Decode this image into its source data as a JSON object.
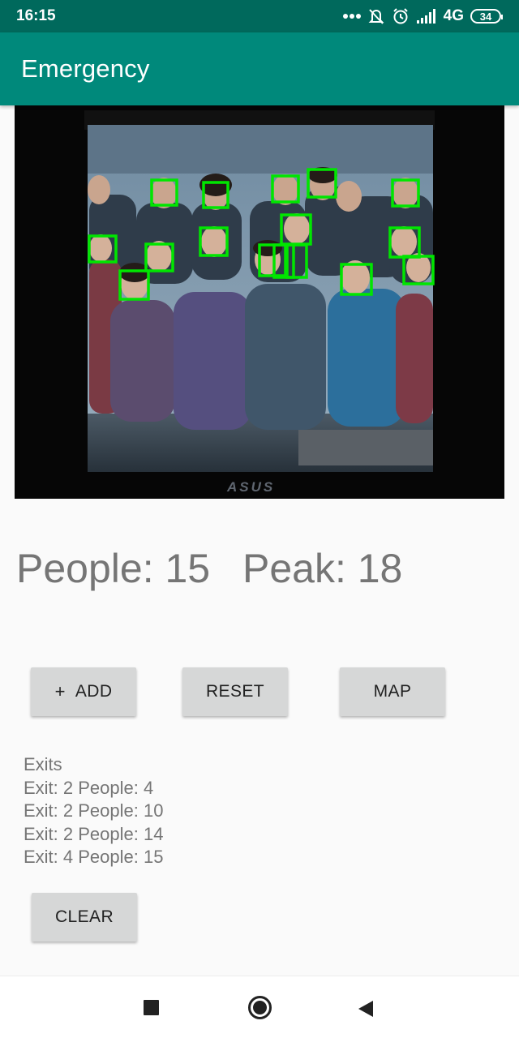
{
  "status_bar": {
    "time": "16:15",
    "network": "4G",
    "battery": "34",
    "icons": [
      "more-dots-icon",
      "alarm-off-icon",
      "alarm-clock-icon",
      "signal-icon",
      "battery-icon"
    ]
  },
  "app_bar": {
    "title": "Emergency"
  },
  "camera": {
    "brand_text": "ASUS",
    "detected_faces": 18,
    "box_color": "#00e600"
  },
  "counters": {
    "people_label": "People: 15",
    "peak_label": "Peak: 18",
    "people": 15,
    "peak": 18
  },
  "buttons": {
    "add_label": "ADD",
    "add_icon": "+",
    "reset_label": "RESET",
    "map_label": "MAP",
    "clear_label": "CLEAR"
  },
  "exits": {
    "header": "Exits",
    "items": [
      "Exit: 2 People: 4",
      "Exit: 2 People: 10",
      "Exit: 2 People: 14",
      "Exit: 4 People: 15"
    ]
  },
  "nav": {
    "recents_icon": "recents-square-icon",
    "home_icon": "home-circle-icon",
    "back_icon": "back-triangle-icon"
  },
  "colors": {
    "status_bar": "#00695c",
    "app_bar": "#00897b",
    "background": "#fafafa",
    "button": "#d6d7d7",
    "text_gray": "#757575"
  }
}
